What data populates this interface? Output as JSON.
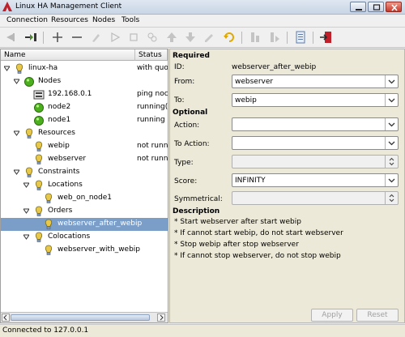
{
  "window": {
    "title": "Linux HA Management Client"
  },
  "menu": [
    "Connection",
    "Resources",
    "Nodes",
    "Tools"
  ],
  "tree": {
    "headers": {
      "name": "Name",
      "status": "Status"
    },
    "rows": [
      {
        "label": "linux-ha",
        "status": "with quo",
        "icon": "cluster-icon",
        "expander": "open"
      },
      {
        "label": "Nodes",
        "status": "",
        "icon": "green-circle-icon",
        "expander": "open"
      },
      {
        "label": "192.168.0.1",
        "status": "ping noc",
        "icon": "ping-node-icon",
        "expander": ""
      },
      {
        "label": "node2",
        "status": "running(",
        "icon": "node-online-icon",
        "expander": ""
      },
      {
        "label": "node1",
        "status": "running",
        "icon": "node-online-icon",
        "expander": ""
      },
      {
        "label": "Resources",
        "status": "",
        "icon": "resource-icon",
        "expander": "open"
      },
      {
        "label": "webip",
        "status": "not runni",
        "icon": "resource-icon",
        "expander": ""
      },
      {
        "label": "webserver",
        "status": "not runni",
        "icon": "resource-icon",
        "expander": ""
      },
      {
        "label": "Constraints",
        "status": "",
        "icon": "constraint-icon",
        "expander": "open"
      },
      {
        "label": "Locations",
        "status": "",
        "icon": "constraint-icon",
        "expander": "open"
      },
      {
        "label": "web_on_node1",
        "status": "",
        "icon": "constraint-icon",
        "expander": ""
      },
      {
        "label": "Orders",
        "status": "",
        "icon": "constraint-icon",
        "expander": "open"
      },
      {
        "label": "webserver_after_webip",
        "status": "",
        "icon": "constraint-icon",
        "expander": "",
        "selected": true
      },
      {
        "label": "Colocations",
        "status": "",
        "icon": "constraint-icon",
        "expander": "open"
      },
      {
        "label": "webserver_with_webip",
        "status": "",
        "icon": "constraint-icon",
        "expander": ""
      }
    ]
  },
  "form": {
    "required_title": "Required",
    "id_label": "ID:",
    "id_value": "webserver_after_webip",
    "from_label": "From:",
    "from_value": "webserver",
    "to_label": "To:",
    "to_value": "webip",
    "optional_title": "Optional",
    "action_label": "Action:",
    "action_value": "",
    "to_action_label": "To Action:",
    "to_action_value": "",
    "type_label": "Type:",
    "type_value": "",
    "score_label": "Score:",
    "score_value": "INFINITY",
    "symmetrical_label": "Symmetrical:",
    "symmetrical_value": "",
    "description_title": "Description",
    "description_lines": [
      "* Start webserver after start webip",
      "* If cannot start webip, do not start webserver",
      "* Stop webip after stop webserver",
      "* If cannot stop webserver, do not stop webip"
    ],
    "apply_label": "Apply",
    "reset_label": "Reset"
  },
  "status_bar": {
    "text": "Connected to 127.0.0.1"
  },
  "colors": {
    "selection": "#7b9ec9",
    "node_online": "#4caf1e",
    "bulb": "#e8c84a",
    "exit_red": "#c0202a"
  }
}
